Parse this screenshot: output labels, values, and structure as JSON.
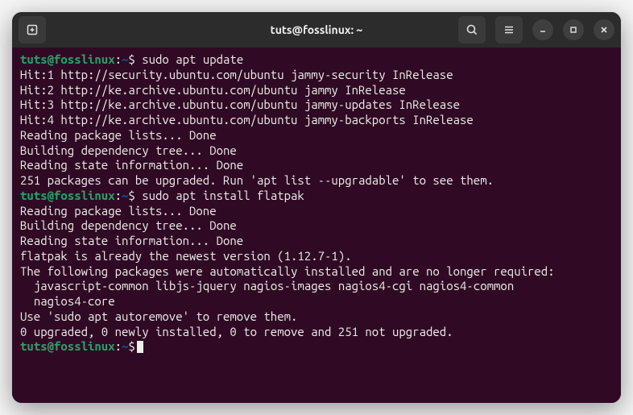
{
  "titlebar": {
    "title": "tuts@fosslinux: ~"
  },
  "prompt": {
    "user_host": "tuts@fosslinux",
    "sep1": ":",
    "path": "~",
    "sep2": "$"
  },
  "session": {
    "cmd1": "sudo apt update",
    "out1": [
      "Hit:1 http://security.ubuntu.com/ubuntu jammy-security InRelease",
      "Hit:2 http://ke.archive.ubuntu.com/ubuntu jammy InRelease",
      "Hit:3 http://ke.archive.ubuntu.com/ubuntu jammy-updates InRelease",
      "Hit:4 http://ke.archive.ubuntu.com/ubuntu jammy-backports InRelease",
      "Reading package lists... Done",
      "Building dependency tree... Done",
      "Reading state information... Done",
      "251 packages can be upgraded. Run 'apt list --upgradable' to see them."
    ],
    "cmd2": "sudo apt install flatpak",
    "out2": [
      "Reading package lists... Done",
      "Building dependency tree... Done",
      "Reading state information... Done",
      "flatpak is already the newest version (1.12.7-1).",
      "The following packages were automatically installed and are no longer required:",
      "  javascript-common libjs-jquery nagios-images nagios4-cgi nagios4-common",
      "  nagios4-core",
      "Use 'sudo apt autoremove' to remove them.",
      "0 upgraded, 0 newly installed, 0 to remove and 251 not upgraded."
    ]
  }
}
